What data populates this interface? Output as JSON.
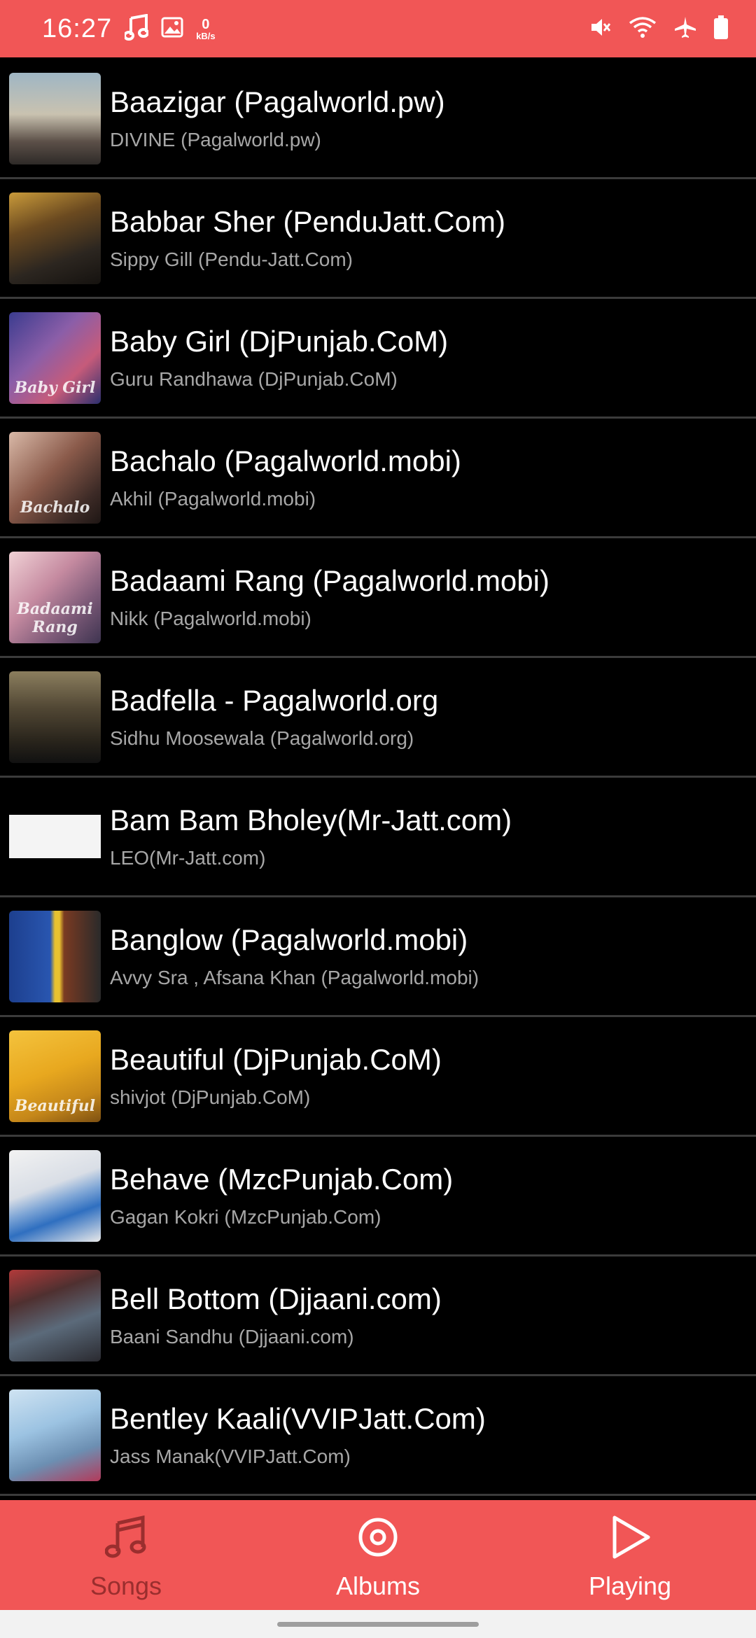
{
  "status_bar": {
    "time": "16:27",
    "net_speed_value": "0",
    "net_speed_unit": "kB/s",
    "icons": [
      "music-note-icon",
      "image-icon",
      "mute-icon",
      "wifi-icon",
      "airplane-icon",
      "battery-icon"
    ]
  },
  "songs": [
    {
      "title": "Baazigar (Pagalworld.pw)",
      "artist": "DIVINE (Pagalworld.pw)"
    },
    {
      "title": "Babbar Sher (PenduJatt.Com)",
      "artist": "Sippy Gill (Pendu-Jatt.Com)"
    },
    {
      "title": "Baby Girl (DjPunjab.CoM)",
      "artist": "Guru Randhawa (DjPunjab.CoM)"
    },
    {
      "title": "Bachalo (Pagalworld.mobi)",
      "artist": "Akhil (Pagalworld.mobi)"
    },
    {
      "title": "Badaami Rang (Pagalworld.mobi)",
      "artist": "Nikk (Pagalworld.mobi)"
    },
    {
      "title": "Badfella - Pagalworld.org",
      "artist": "Sidhu Moosewala (Pagalworld.org)"
    },
    {
      "title": "Bam Bam Bholey(Mr-Jatt.com)",
      "artist": "LEO(Mr-Jatt.com)"
    },
    {
      "title": "Banglow (Pagalworld.mobi)",
      "artist": "Avvy Sra , Afsana Khan (Pagalworld.mobi)"
    },
    {
      "title": "Beautiful (DjPunjab.CoM)",
      "artist": "shivjot (DjPunjab.CoM)"
    },
    {
      "title": "Behave (MzcPunjab.Com)",
      "artist": "Gagan Kokri (MzcPunjab.Com)"
    },
    {
      "title": "Bell Bottom (Djjaani.com)",
      "artist": "Baani Sandhu (Djjaani.com)"
    },
    {
      "title": "Bentley Kaali(VVIPJatt.Com)",
      "artist": "Jass Manak(VVIPJatt.Com)"
    }
  ],
  "bottom_nav": {
    "songs": "Songs",
    "albums": "Albums",
    "playing": "Playing"
  },
  "colors": {
    "accent": "#f15656",
    "active_nav": "#9a2e2e",
    "background": "#000000",
    "secondary_text": "#a7a7a7"
  }
}
